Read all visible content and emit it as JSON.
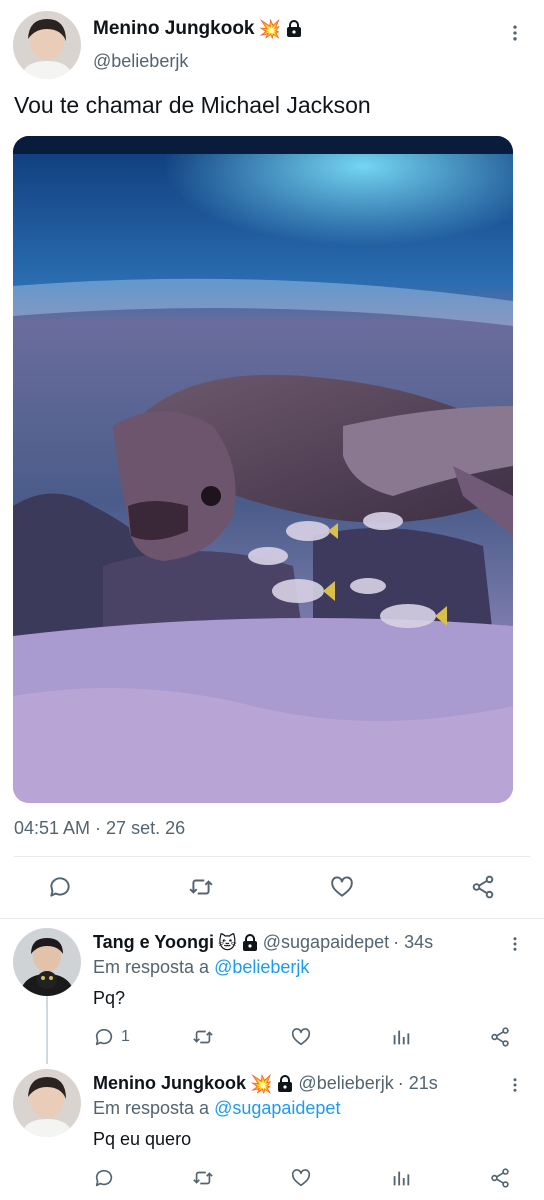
{
  "main_tweet": {
    "author_name": "Menino Jungkook",
    "author_emoji": "💥",
    "author_handle": "@belieberjk",
    "text": "Vou te chamar de Michael Jackson",
    "timestamp": "04:51 AM · 27 set. 26",
    "media_description_icon": "turtle-aquarium-photo"
  },
  "replies": [
    {
      "author_name": "Tang e Yoongi",
      "author_emoji": "🐱",
      "author_handle": "@sugapaidepet",
      "age": "· 34s",
      "reply_to_prefix": "Em resposta a",
      "reply_to_handle": "@belieberjk",
      "text": "Pq?",
      "reply_count": "1"
    },
    {
      "author_name": "Menino Jungkook",
      "author_emoji": "💥",
      "author_handle": "@belieberjk",
      "age": "· 21s",
      "reply_to_prefix": "Em resposta a",
      "reply_to_handle": "@sugapaidepet",
      "text": "Pq eu quero",
      "reply_count": ""
    }
  ],
  "colors": {
    "text_primary": "#0f1419",
    "text_secondary": "#536471",
    "link": "#1d9bf0",
    "divider": "#e6ecf0"
  }
}
